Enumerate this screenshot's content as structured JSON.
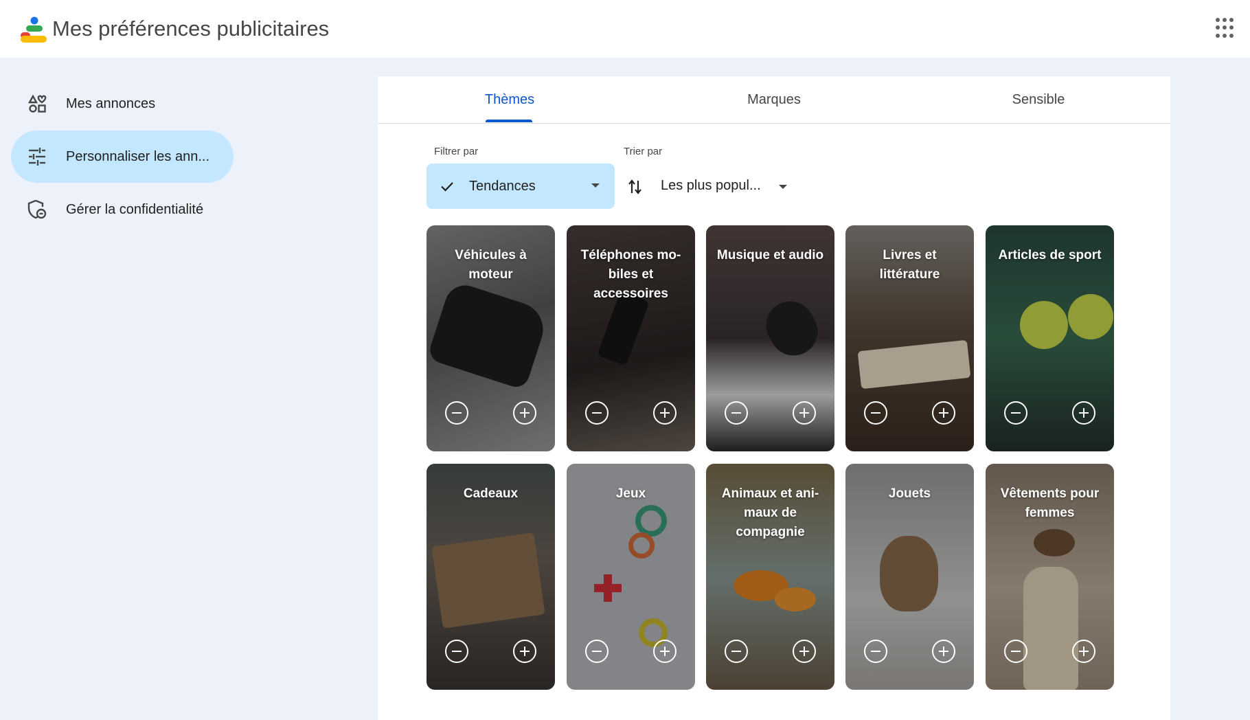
{
  "header": {
    "title": "Mes préférences publicitaires",
    "logo_icon": "ad-preferences-logo",
    "apps_icon": "google-apps-icon"
  },
  "sidebar": {
    "items": [
      {
        "label": "Mes annonces",
        "icon": "shapes-icon",
        "active": false
      },
      {
        "label": "Personnaliser les ann...",
        "icon": "tune-icon",
        "active": true
      },
      {
        "label": "Gérer la confidentialité",
        "icon": "privacy-shield-icon",
        "active": false
      }
    ]
  },
  "tabs": [
    {
      "label": "Thèmes",
      "active": true
    },
    {
      "label": "Marques",
      "active": false
    },
    {
      "label": "Sensible",
      "active": false
    }
  ],
  "filter": {
    "label": "Filtrer par",
    "value": "Tendances",
    "check_icon": "check-icon",
    "dropdown_icon": "caret-down-icon"
  },
  "sort": {
    "label": "Trier par",
    "value": "Les plus popul...",
    "sort_icon": "swap-vert-icon",
    "dropdown_icon": "caret-down-icon"
  },
  "cards": [
    {
      "title": "Véhicules à moteur",
      "bg": "#6b6b6b"
    },
    {
      "title": "Téléphones mo-biles et accessoires",
      "bg": "#3a3230"
    },
    {
      "title": "Musique et audio",
      "bg": "#4a4040"
    },
    {
      "title": "Livres et littérature",
      "bg": "#7a6a5a"
    },
    {
      "title": "Articles de sport",
      "bg": "#2f4a40"
    },
    {
      "title": "Cadeaux",
      "bg": "#5a5048"
    },
    {
      "title": "Jeux",
      "bg": "#9a9ea4"
    },
    {
      "title": "Animaux et ani-maux de compagnie",
      "bg": "#6f6a58"
    },
    {
      "title": "Jouets",
      "bg": "#8a8a88"
    },
    {
      "title": "Vêtements pour femmes",
      "bg": "#8a7a68"
    }
  ],
  "colors": {
    "accent": "#0b57d0",
    "active_chip": "#c2e7ff",
    "page_bg": "#edf2fa"
  }
}
